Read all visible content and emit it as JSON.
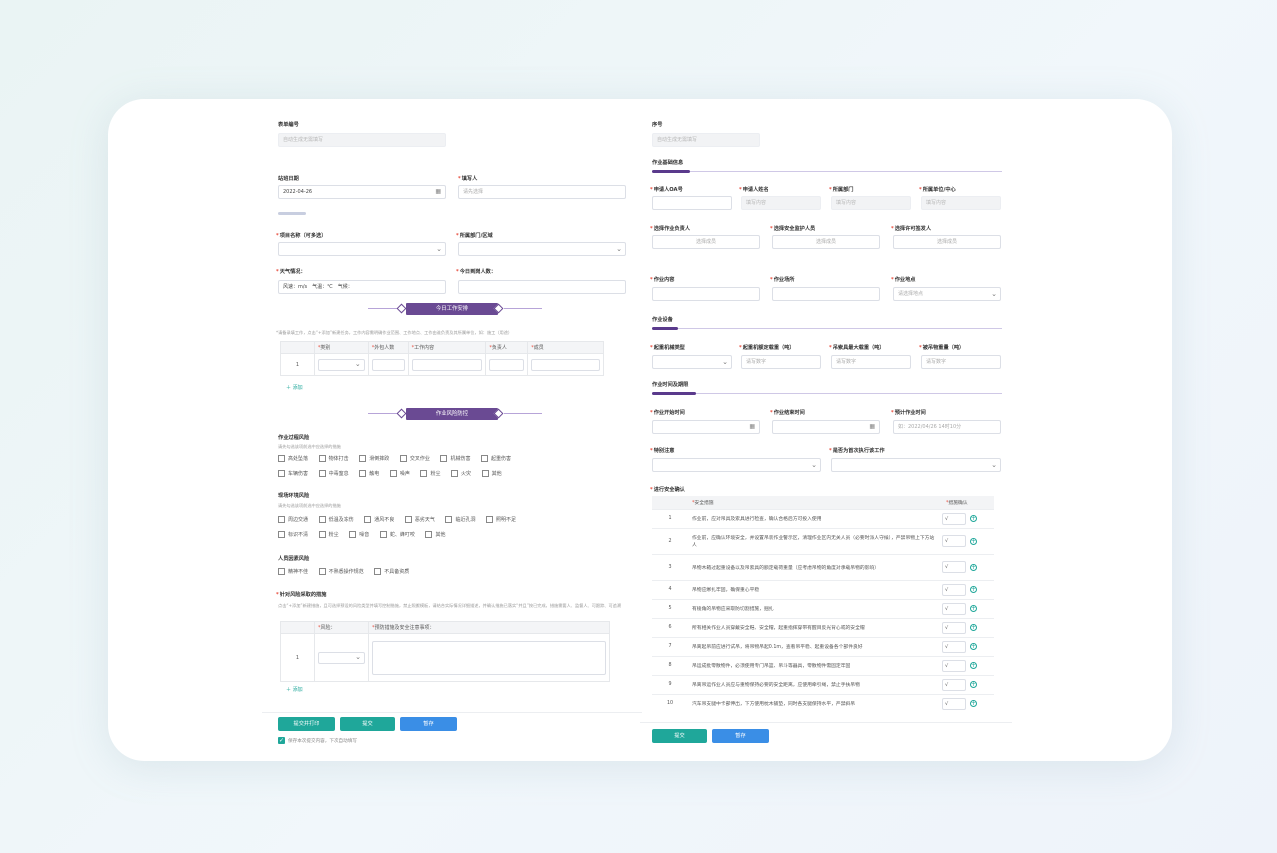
{
  "left": {
    "form_no": {
      "label": "表单编号",
      "placeholder": "自动生成无需填写"
    },
    "date": {
      "label": "站班日期",
      "value": "2022-04-26"
    },
    "filler": {
      "label": "填写人",
      "placeholder": "请先选择"
    },
    "project": {
      "label": "项目名称（可多选）"
    },
    "dept": {
      "label": "所属部门/区域"
    },
    "weather": {
      "label": "天气情况：",
      "value": "风速：m/s　气温：℃　气候："
    },
    "attendance": {
      "label": "今日到岗人数："
    },
    "work_banner": "今日工作安排",
    "work_hint": "*请备录填工作，点击“+添加”新建任务，工作内容需明确作业范围、工作地点、工作由谁负责及其所属单位，如：施工（用途）",
    "work_table": {
      "headers": [
        "",
        "类别",
        "外包人数",
        "工作内容",
        "负责人",
        "成员"
      ],
      "row_index": "1"
    },
    "add_label": "＋ 添加",
    "risk_banner": "作业风险防控",
    "process_risk": {
      "title": "作业过程风险",
      "hint": "请先勾选该项前选中应选择的措施",
      "items_row1": [
        "高处坠落",
        "物体打击",
        "滑倒摔跤",
        "交叉作业",
        "机械伤害",
        "起重伤害"
      ],
      "items_row2": [
        "车辆伤害",
        "中毒窒息",
        "触电",
        "噪声",
        "粉尘",
        "火灾",
        "其他"
      ]
    },
    "env_risk": {
      "title": "现场环境风险",
      "hint": "请先勾选该项前选中应选择的措施",
      "items_row1": [
        "周边交通",
        "低温及冻伤",
        "通风不良",
        "恶劣天气",
        "临近孔洞",
        "照明不足"
      ],
      "items_row2": [
        "标识不清",
        "粉尘",
        "噪音",
        "蛇、蜂叮咬",
        "其他"
      ]
    },
    "human_risk": {
      "title": "人员因素风险",
      "items": [
        "精神不佳",
        "不熟悉操作规范",
        "不具备资质"
      ]
    },
    "measures": {
      "title": "针对风险采取的措施",
      "hint": "点击“+添加”新建措施，且可选择预设的风险类型并填写控制措施，禁止照搬模板，请结合实际情况详细描述，并确认措施已落实“并且”按已完成，措施需要人、监督人、可跟踪、可追溯",
      "headers": [
        "",
        "风险：",
        "预防措施及安全注意事项："
      ],
      "row_index": "1"
    },
    "buttons": {
      "submit_print": "提交并打印",
      "submit": "提交",
      "save": "暂存"
    },
    "remember": "保存本次提交内容，下次自动填写"
  },
  "right": {
    "seq": {
      "label": "序号",
      "placeholder": "自动生成无需填写"
    },
    "basic_title": "作业基础信息",
    "applicant_oa": {
      "label": "申请人OA号"
    },
    "applicant_name": {
      "label": "申请人姓名",
      "placeholder": "填写内容"
    },
    "belong_dept": {
      "label": "所属部门",
      "placeholder": "填写内容"
    },
    "belong_unit": {
      "label": "所属单位/中心",
      "placeholder": "填写内容"
    },
    "work_leader": {
      "label": "选择作业负责人",
      "placeholder": "选择成员"
    },
    "safety_leader": {
      "label": "选择安全监护人员",
      "placeholder": "选择成员"
    },
    "permit_person": {
      "label": "选择许可签发人",
      "placeholder": "选择成员"
    },
    "work_content": {
      "label": "作业内容"
    },
    "work_area": {
      "label": "作业场所"
    },
    "work_site": {
      "label": "作业地点",
      "placeholder": "请选择地点"
    },
    "equip_title": "作业设备",
    "crane_type": {
      "label": "起重机械类型"
    },
    "lift_weight": {
      "label": "起重机额定载重（吨）",
      "placeholder": "请写数字"
    },
    "rigging_weight": {
      "label": "吊索具最大载重（吨）",
      "placeholder": "请写数字"
    },
    "load_weight": {
      "label": "被吊物重量（吨）",
      "placeholder": "请写数字"
    },
    "time_title": "作业时间及期限",
    "start_time": {
      "label": "作业开始时间"
    },
    "end_time": {
      "label": "作业结束时间"
    },
    "plan_time": {
      "label": "预计作业时间",
      "placeholder": "如：2022/04/26 14时10分"
    },
    "special_req": {
      "label": "特别注意"
    },
    "repeat_work": {
      "label": "是否为首次执行该工作"
    },
    "confirm_title": "进行安全确认",
    "confirm_headers": [
      "",
      "安全措施",
      "措施确认"
    ],
    "confirm_rows": [
      {
        "no": "1",
        "text": "作业前，应对吊具及索具进行检查，确认合格后方可投入使用",
        "ok": "√"
      },
      {
        "no": "2",
        "text": "作业前，应确认环境安全，并设置吊装作业警示区，清理作业区内无关人员（必要时派人守候），严禁吊物上下方站人",
        "ok": "√"
      },
      {
        "no": "3",
        "text": "吊物木箱过起重设备以及吊索具的额定载荷重量（应考虑吊物的角度对承载吊物的影响）",
        "ok": "√"
      },
      {
        "no": "4",
        "text": "吊物应绑扎牢固，确保重心平稳",
        "ok": "√"
      },
      {
        "no": "5",
        "text": "有棱角的吊物应采取防切割措施，捆扎",
        "ok": "√"
      },
      {
        "no": "6",
        "text": "所有相关作业人员穿戴安全鞋、安全帽，起重指挥穿带有醒目反光背心或的安全帽",
        "ok": "√"
      },
      {
        "no": "7",
        "text": "吊离起吊前应进行试吊，将吊物吊起0.1m，查看吊平稳、起重设备各个部件良好",
        "ok": "√"
      },
      {
        "no": "8",
        "text": "吊运成批零散物件，必须使用专门吊篮、吊斗等器具，零散物件需固定牢固",
        "ok": "√"
      },
      {
        "no": "9",
        "text": "吊离吊运作业人员应与重物保持必要的安全距离，应使用牵引绳，禁止手扶吊物",
        "ok": "√"
      },
      {
        "no": "10",
        "text": "汽车吊支腿中卡部伸出，下方使用枕木铺垫，同时各支腿保持水平，严禁斜吊",
        "ok": "√"
      }
    ],
    "buttons": {
      "submit": "提交",
      "save": "暂存"
    }
  }
}
